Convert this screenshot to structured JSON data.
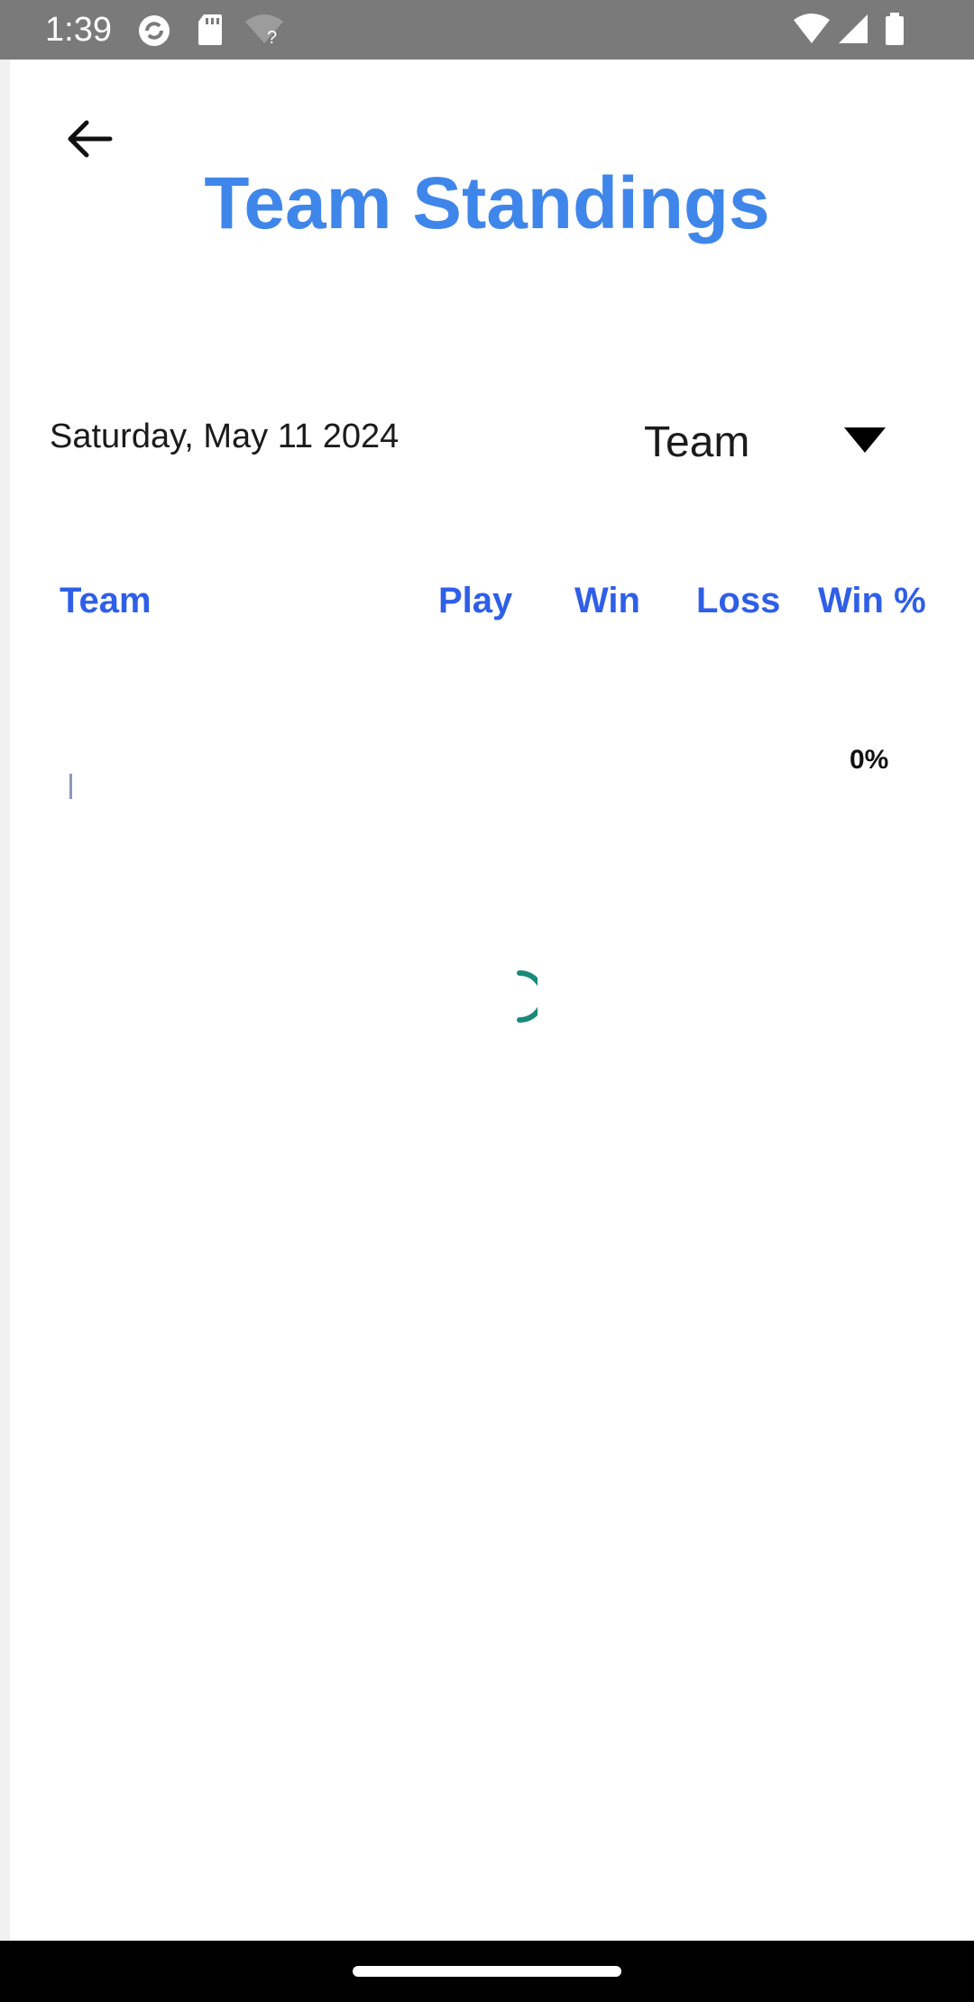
{
  "status_bar": {
    "time": "1:39",
    "icons": [
      "sync-icon",
      "sd-card-icon",
      "wifi-question-icon",
      "wifi-icon",
      "signal-icon",
      "battery-icon"
    ]
  },
  "header": {
    "back_icon": "arrow-back-icon",
    "title": "Team Standings",
    "title_color": "#3f86ea"
  },
  "filters": {
    "date": "Saturday, May 11 2024",
    "dropdown": {
      "selected": "Team",
      "icon": "triangle-down-icon"
    }
  },
  "table": {
    "header_color": "#2f5fe8",
    "columns": [
      "Team",
      "Play",
      "Win",
      "Loss",
      "Win %"
    ],
    "rows": [
      {
        "team": "",
        "play": "",
        "win": "",
        "loss": "",
        "win_pct": "0%"
      }
    ]
  },
  "loading": {
    "spinner_color": "#1a8a7a"
  }
}
